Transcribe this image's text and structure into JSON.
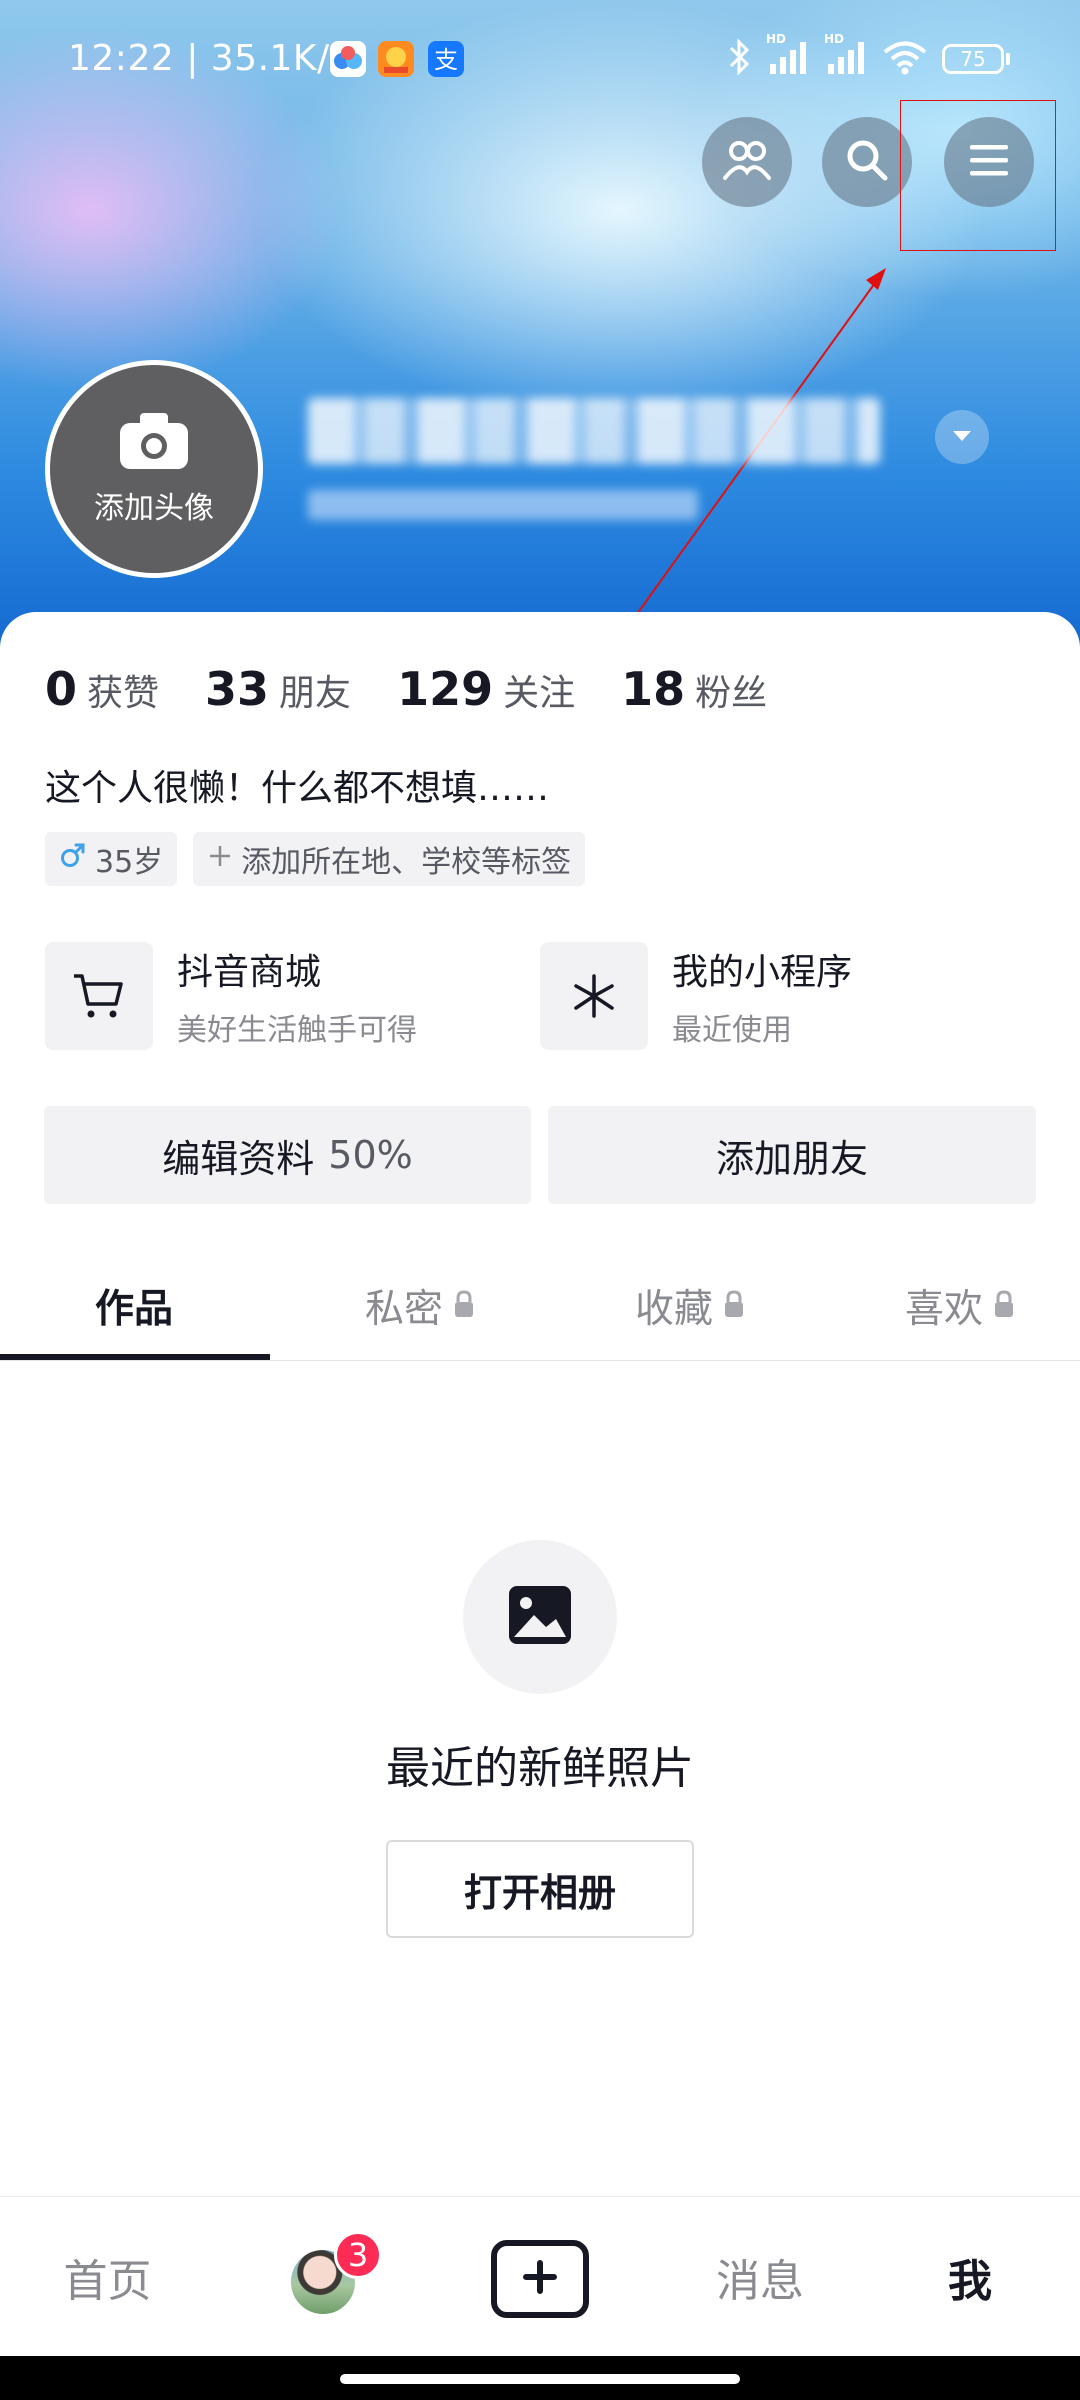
{
  "status_bar": {
    "time_speed": "12:22 | 35.1K/s",
    "signal_label": "HD",
    "battery": "75",
    "icons": [
      "baidu-netdisk-icon",
      "orange-app-icon",
      "alipay-icon",
      "bluetooth-icon",
      "signal-icon",
      "signal-icon",
      "wifi-icon",
      "battery-icon"
    ]
  },
  "top_actions": {
    "icons": [
      "friends-icon",
      "search-icon",
      "menu-icon"
    ]
  },
  "profile": {
    "avatar_label": "添加头像",
    "stats": [
      {
        "value": "0",
        "label": "获赞"
      },
      {
        "value": "33",
        "label": "朋友"
      },
      {
        "value": "129",
        "label": "关注"
      },
      {
        "value": "18",
        "label": "粉丝"
      }
    ],
    "bio": "这个人很懒！什么都不想填……",
    "tags": {
      "age": "35岁",
      "add_tags": "添加所在地、学校等标签"
    }
  },
  "services": [
    {
      "title": "抖音商城",
      "subtitle": "美好生活触手可得",
      "icon": "cart-icon"
    },
    {
      "title": "我的小程序",
      "subtitle": "最近使用",
      "icon": "mini-program-icon"
    }
  ],
  "actions": {
    "edit_profile": "编辑资料",
    "edit_percent": "50%",
    "add_friends": "添加朋友"
  },
  "tabs": [
    {
      "label": "作品",
      "active": true,
      "locked": false
    },
    {
      "label": "私密",
      "active": false,
      "locked": true
    },
    {
      "label": "收藏",
      "active": false,
      "locked": true
    },
    {
      "label": "喜欢",
      "active": false,
      "locked": true
    }
  ],
  "empty_state": {
    "title": "最近的新鲜照片",
    "button": "打开相册"
  },
  "bottom_nav": {
    "home": "首页",
    "badge": "3",
    "messages": "消息",
    "me": "我"
  },
  "colors": {
    "accent_red": "#fe2c55",
    "annotation_red": "#e01010",
    "gender_blue": "#3fa2e8"
  }
}
